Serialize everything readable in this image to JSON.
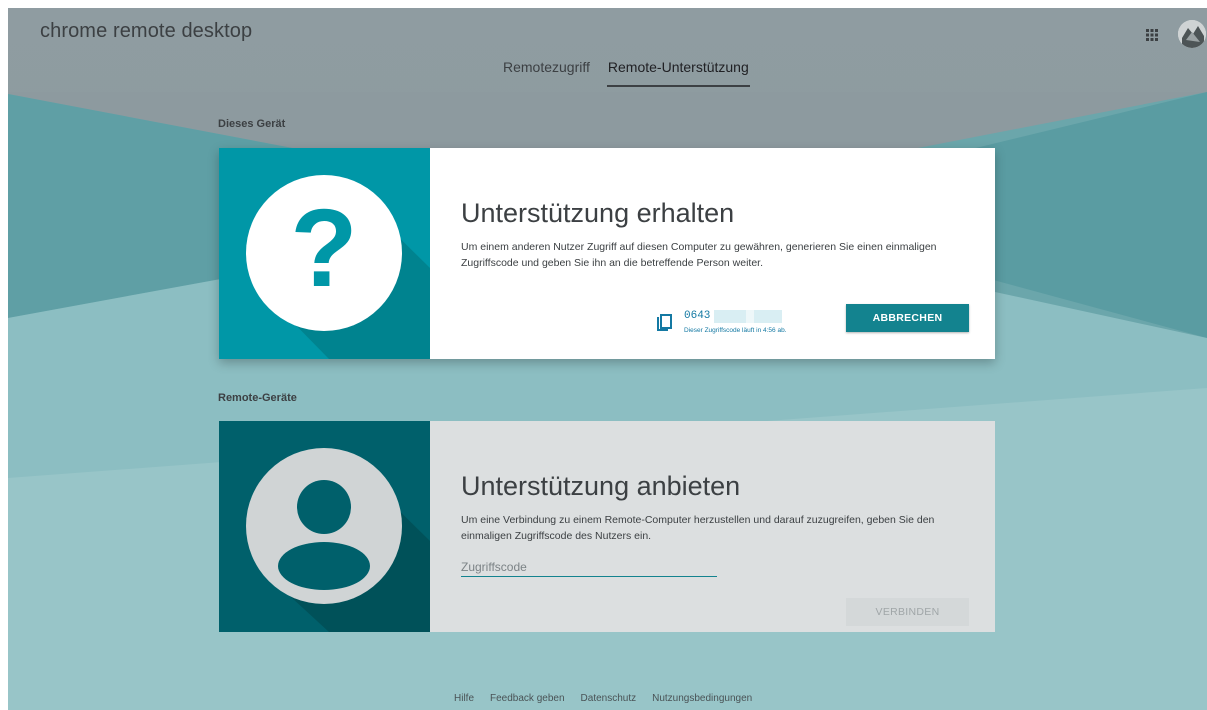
{
  "app": {
    "title": "chrome remote desktop"
  },
  "tabs": [
    {
      "label": "Remotezugriff",
      "active": false
    },
    {
      "label": "Remote-Unterstützung",
      "active": true
    }
  ],
  "sections": {
    "this_device": "Dieses Gerät",
    "remote_devices": "Remote-Geräte"
  },
  "get_support": {
    "title": "Unterstützung erhalten",
    "description": "Um einem anderen Nutzer Zugriff auf diesen Computer zu gewähren, generieren Sie einen einmaligen Zugriffscode und geben Sie ihn an die betreffende Person weiter.",
    "code_prefix": "0643",
    "code_note": "Dieser Zugriffscode läuft in 4:56 ab.",
    "cancel_label": "ABBRECHEN",
    "icon": "question-mark-icon"
  },
  "give_support": {
    "title": "Unterstützung anbieten",
    "description": "Um eine Verbindung zu einem Remote-Computer herzustellen und darauf zuzugreifen, geben Sie den einmaligen Zugriffscode des Nutzers ein.",
    "input_placeholder": "Zugriffscode",
    "connect_label": "VERBINDEN",
    "icon": "person-icon"
  },
  "footer": [
    "Hilfe",
    "Feedback geben",
    "Datenschutz",
    "Nutzungsbedingungen"
  ],
  "colors": {
    "accent": "#13838f",
    "teal_light": "#0097a7",
    "teal_dark": "#00606b",
    "background_gray": "#8f9ca1"
  }
}
